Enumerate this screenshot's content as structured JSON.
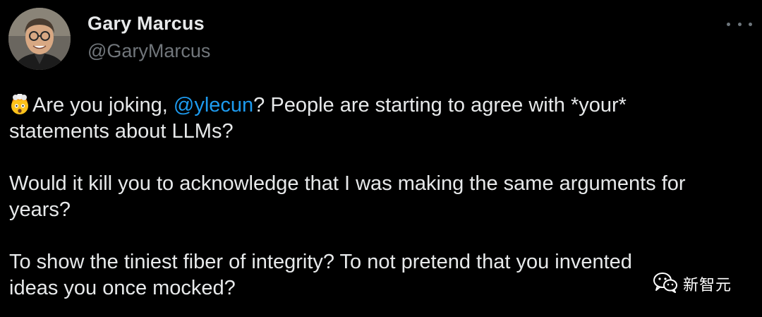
{
  "tweet": {
    "author_name": "Gary Marcus",
    "author_handle": "@GaryMarcus",
    "more_icon": "ellipsis-icon",
    "emoji_icon": "exploding-head-emoji",
    "lines": {
      "l1_before": "Are you joking, ",
      "l1_mention": "@ylecun",
      "l1_after": "? People are starting to agree with *your*",
      "l2": "statements about LLMs?",
      "l3": "Would it kill you to acknowledge that I was making the same arguments for",
      "l4": "years?",
      "l5": "To show the tiniest fiber of integrity? To not pretend that you invented",
      "l6": "ideas you once mocked?"
    }
  },
  "watermark": {
    "text": "新智元",
    "icon": "wechat-icon"
  },
  "colors": {
    "background": "#000000",
    "text": "#e7e9ea",
    "secondary": "#71767b",
    "mention": "#1d9bf0"
  }
}
